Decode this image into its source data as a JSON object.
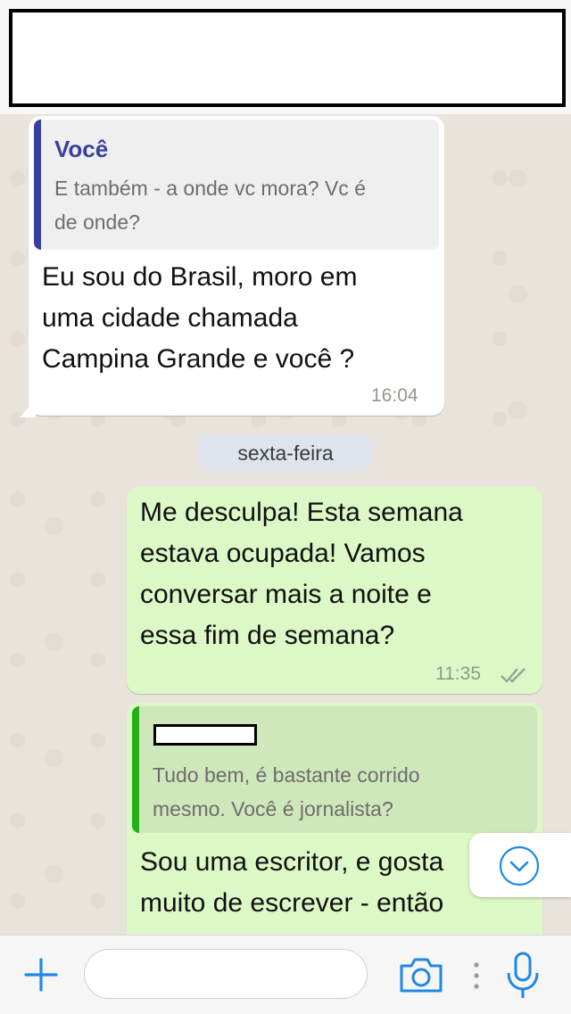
{
  "header": {
    "redacted": true
  },
  "messages": [
    {
      "direction": "incoming",
      "quote": {
        "author": "Você",
        "text_line1": "E também - a onde vc mora? Vc é",
        "text_line2": "de onde?"
      },
      "lines": [
        "Eu sou do Brasil, moro em",
        "uma cidade chamada",
        "Campina Grande e você ?"
      ],
      "time": "16:04"
    },
    {
      "direction": "outgoing",
      "lines": [
        "Me desculpa! Esta semana",
        "estava ocupada! Vamos",
        "conversar mais a noite e",
        "essa fim de semana?"
      ],
      "time": "11:35",
      "status": "read"
    },
    {
      "direction": "outgoing",
      "quote": {
        "author_redacted": true,
        "text_line1": "Tudo bem, é bastante corrido",
        "text_line2": "mesmo. Você é jornalista?"
      },
      "lines": [
        "Sou uma escritor, e gosta",
        "muito de escrever - então"
      ]
    }
  ],
  "date_separator": "sexta-feira",
  "input": {
    "placeholder": ""
  },
  "colors": {
    "incoming_bubble": "#ffffff",
    "outgoing_bubble": "#dcf8c6",
    "quote_author_you": "#3a3f9b",
    "quote_bar_you": "#3a3f9b",
    "quote_bar_green": "#23b116",
    "accent": "#1e88e5"
  },
  "icons": [
    "plus-icon",
    "camera-icon",
    "more-dots-icon",
    "microphone-icon",
    "chevron-down-icon",
    "double-check-icon"
  ]
}
